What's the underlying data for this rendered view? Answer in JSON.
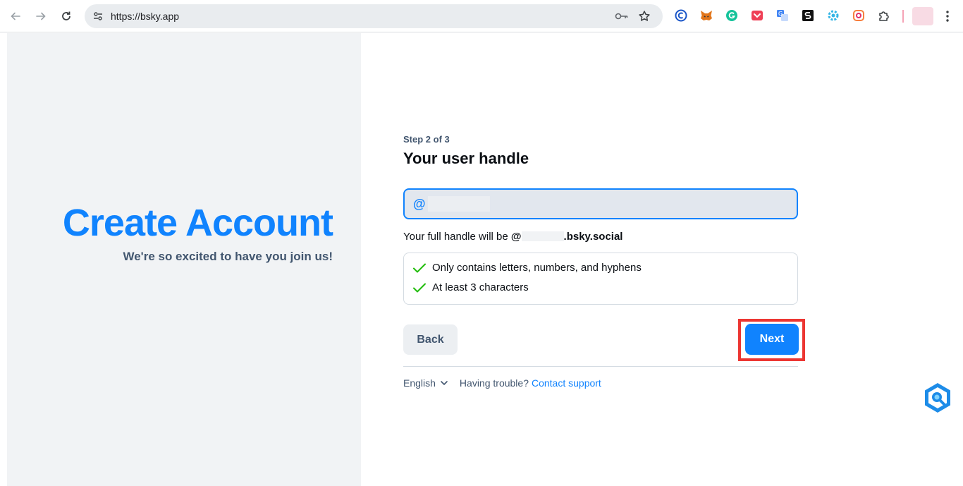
{
  "browser": {
    "url": "https://bsky.app",
    "extensions": [
      "c-icon",
      "fox-icon",
      "grammarly-icon",
      "pocket-icon",
      "translate-icon",
      "s-icon",
      "gear-blue-icon",
      "camera-icon",
      "puzzle-icon"
    ]
  },
  "left": {
    "headline": "Create Account",
    "subhead": "We're so excited to have you join us!"
  },
  "form": {
    "step": "Step 2 of 3",
    "title": "Your user handle",
    "at_symbol": "@",
    "input_value": "",
    "full_handle_prefix": "Your full handle will be",
    "full_handle_at": "@",
    "full_handle_suffix": ".bsky.social",
    "checks": [
      "Only contains letters, numbers, and hyphens",
      "At least 3 characters"
    ],
    "back_label": "Back",
    "next_label": "Next"
  },
  "footer": {
    "language": "English",
    "trouble": "Having trouble?",
    "support": "Contact support"
  },
  "colors": {
    "brand": "#1083fe",
    "check": "#20bc07",
    "highlight": "#ec3632"
  }
}
